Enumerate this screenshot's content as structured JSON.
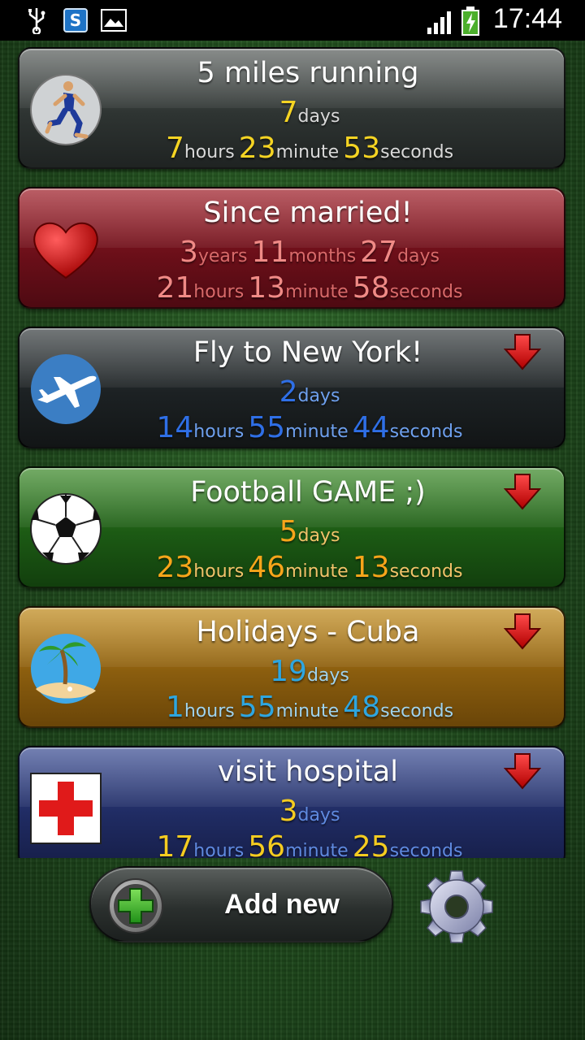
{
  "status_bar": {
    "time": "17:44",
    "icons": [
      "usb-icon",
      "s-app-icon",
      "image-icon",
      "signal-icon",
      "battery-charging-icon"
    ]
  },
  "counters": [
    {
      "title": "5 miles running",
      "icon": "runner-icon",
      "has_arrow": false,
      "theme": "gray",
      "number_color": "#f5d423",
      "unit_color": "#d9d9d9",
      "line1": [
        {
          "num": "7",
          "unit": "days"
        }
      ],
      "line2": [
        {
          "num": "7",
          "unit": "hours"
        },
        {
          "num": "23",
          "unit": "minute"
        },
        {
          "num": "53",
          "unit": "seconds"
        }
      ]
    },
    {
      "title": "Since married!",
      "icon": "heart-icon",
      "has_arrow": false,
      "theme": "red",
      "number_color": "#f08a86",
      "unit_color": "#d96a6a",
      "line1": [
        {
          "num": "3",
          "unit": "years"
        },
        {
          "num": "11",
          "unit": "months"
        },
        {
          "num": "27",
          "unit": "days"
        }
      ],
      "line2": [
        {
          "num": "21",
          "unit": "hours"
        },
        {
          "num": "13",
          "unit": "minute"
        },
        {
          "num": "58",
          "unit": "seconds"
        }
      ]
    },
    {
      "title": "Fly to New York!",
      "icon": "airplane-icon",
      "has_arrow": true,
      "theme": "dark",
      "number_color": "#2f6fe6",
      "unit_color": "#6ea0ee",
      "line1": [
        {
          "num": "2",
          "unit": "days"
        }
      ],
      "line2": [
        {
          "num": "14",
          "unit": "hours"
        },
        {
          "num": "55",
          "unit": "minute"
        },
        {
          "num": "44",
          "unit": "seconds"
        }
      ]
    },
    {
      "title": "Football GAME ;)",
      "icon": "soccer-ball-icon",
      "has_arrow": true,
      "theme": "green",
      "number_color": "#f7a51a",
      "unit_color": "#f2c36a",
      "line1": [
        {
          "num": "5",
          "unit": "days"
        }
      ],
      "line2": [
        {
          "num": "23",
          "unit": "hours"
        },
        {
          "num": "46",
          "unit": "minute"
        },
        {
          "num": "13",
          "unit": "seconds"
        }
      ]
    },
    {
      "title": "Holidays - Cuba",
      "icon": "palm-island-icon",
      "has_arrow": true,
      "theme": "gold",
      "number_color": "#2ea6e0",
      "unit_color": "#9fd3ee",
      "line1": [
        {
          "num": "19",
          "unit": "days"
        }
      ],
      "line2": [
        {
          "num": "1",
          "unit": "hours"
        },
        {
          "num": "55",
          "unit": "minute"
        },
        {
          "num": "48",
          "unit": "seconds"
        }
      ]
    },
    {
      "title": "visit hospital",
      "icon": "red-cross-icon",
      "has_arrow": true,
      "theme": "navy",
      "number_color": "#f5cc20",
      "unit_color": "#5f8ae0",
      "line1": [
        {
          "num": "3",
          "unit": "days"
        }
      ],
      "line2": [
        {
          "num": "17",
          "unit": "hours"
        },
        {
          "num": "56",
          "unit": "minute"
        },
        {
          "num": "25",
          "unit": "seconds"
        }
      ]
    }
  ],
  "bottom_bar": {
    "add_label": "Add new",
    "add_icon": "plus-icon",
    "settings_icon": "gear-icon"
  }
}
